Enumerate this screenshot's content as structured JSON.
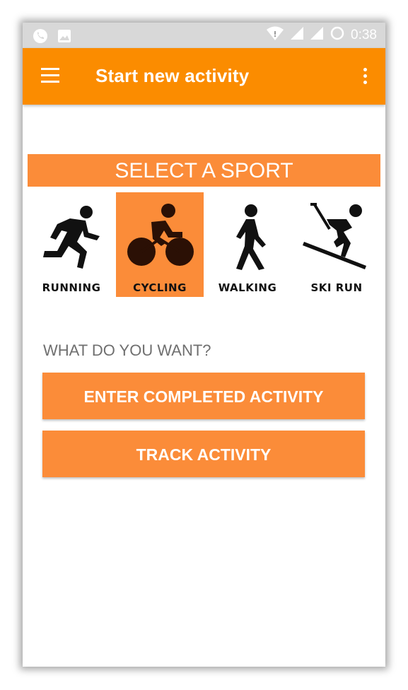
{
  "status_bar": {
    "time": "0:38",
    "left_icons": [
      "phone-icon",
      "image-icon"
    ],
    "right_icons": [
      "wifi-icon",
      "signal-icon",
      "signal-icon",
      "sync-icon"
    ]
  },
  "app_bar": {
    "title": "Start new activity",
    "menu_icon": "hamburger-menu-icon",
    "overflow_icon": "more-vertical-icon"
  },
  "sport_section": {
    "title": "SELECT A SPORT",
    "selected": "CYCLING",
    "sports": [
      {
        "label": "RUNNING",
        "icon": "running-icon"
      },
      {
        "label": "CYCLING",
        "icon": "cycling-icon"
      },
      {
        "label": "WALKING",
        "icon": "walking-icon"
      },
      {
        "label": "SKI RUN",
        "icon": "skiing-icon"
      }
    ]
  },
  "actions": {
    "question": "WHAT DO YOU WANT?",
    "buttons": [
      {
        "label": "ENTER COMPLETED ACTIVITY"
      },
      {
        "label": "TRACK ACTIVITY"
      }
    ]
  },
  "colors": {
    "accent": "#fb8c00",
    "accent_light": "#fb8c39",
    "status_bar": "#d8d8d8"
  }
}
